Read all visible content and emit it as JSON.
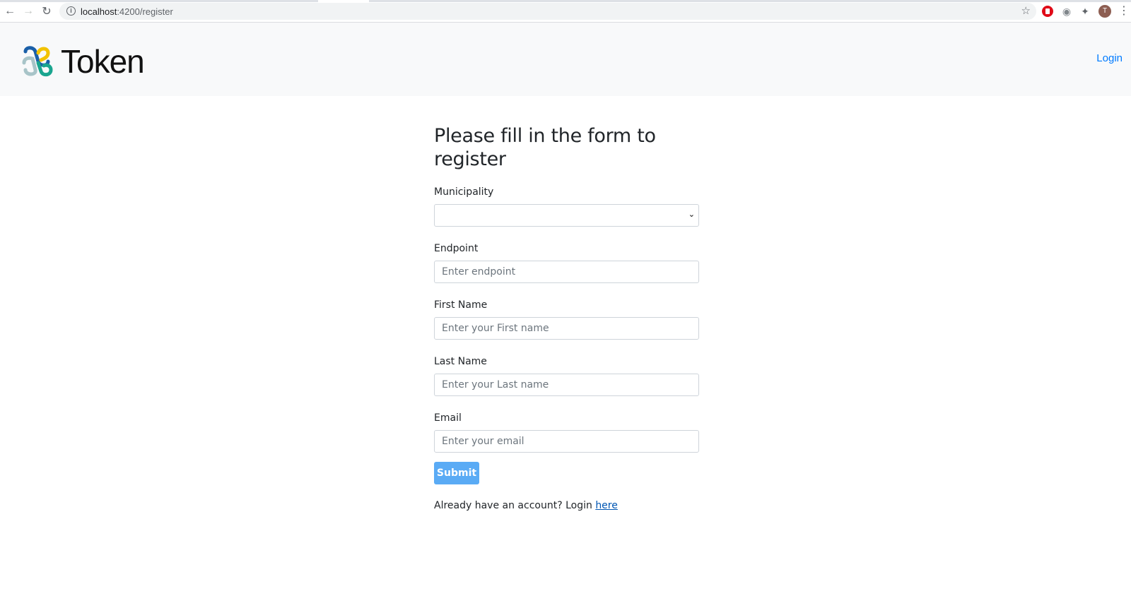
{
  "browser": {
    "url_host": "localhost",
    "url_path": ":4200/register",
    "avatar_initial": "T"
  },
  "navbar": {
    "brand_name": "Token",
    "login_link": "Login"
  },
  "form": {
    "title": "Please fill in the form to register",
    "fields": [
      {
        "label": "Municipality",
        "type": "select",
        "value": ""
      },
      {
        "label": "Endpoint",
        "placeholder": "Enter endpoint"
      },
      {
        "label": "First Name",
        "placeholder": "Enter your First name"
      },
      {
        "label": "Last Name",
        "placeholder": "Enter your Last name"
      },
      {
        "label": "Email",
        "placeholder": "Enter your email"
      }
    ],
    "submit_label": "Submit",
    "footer_text": "Already have an account? Login ",
    "footer_link": "here"
  },
  "colors": {
    "primary_link": "#007bff",
    "submit_bg": "#5aabf5",
    "navbar_bg": "#f8f9fa"
  },
  "icons": [
    "back-icon",
    "forward-icon",
    "reload-icon",
    "info-icon",
    "star-icon",
    "extension-icon",
    "camera-icon",
    "puzzle-icon",
    "menu-icon",
    "chevron-down-icon",
    "token-logo"
  ]
}
